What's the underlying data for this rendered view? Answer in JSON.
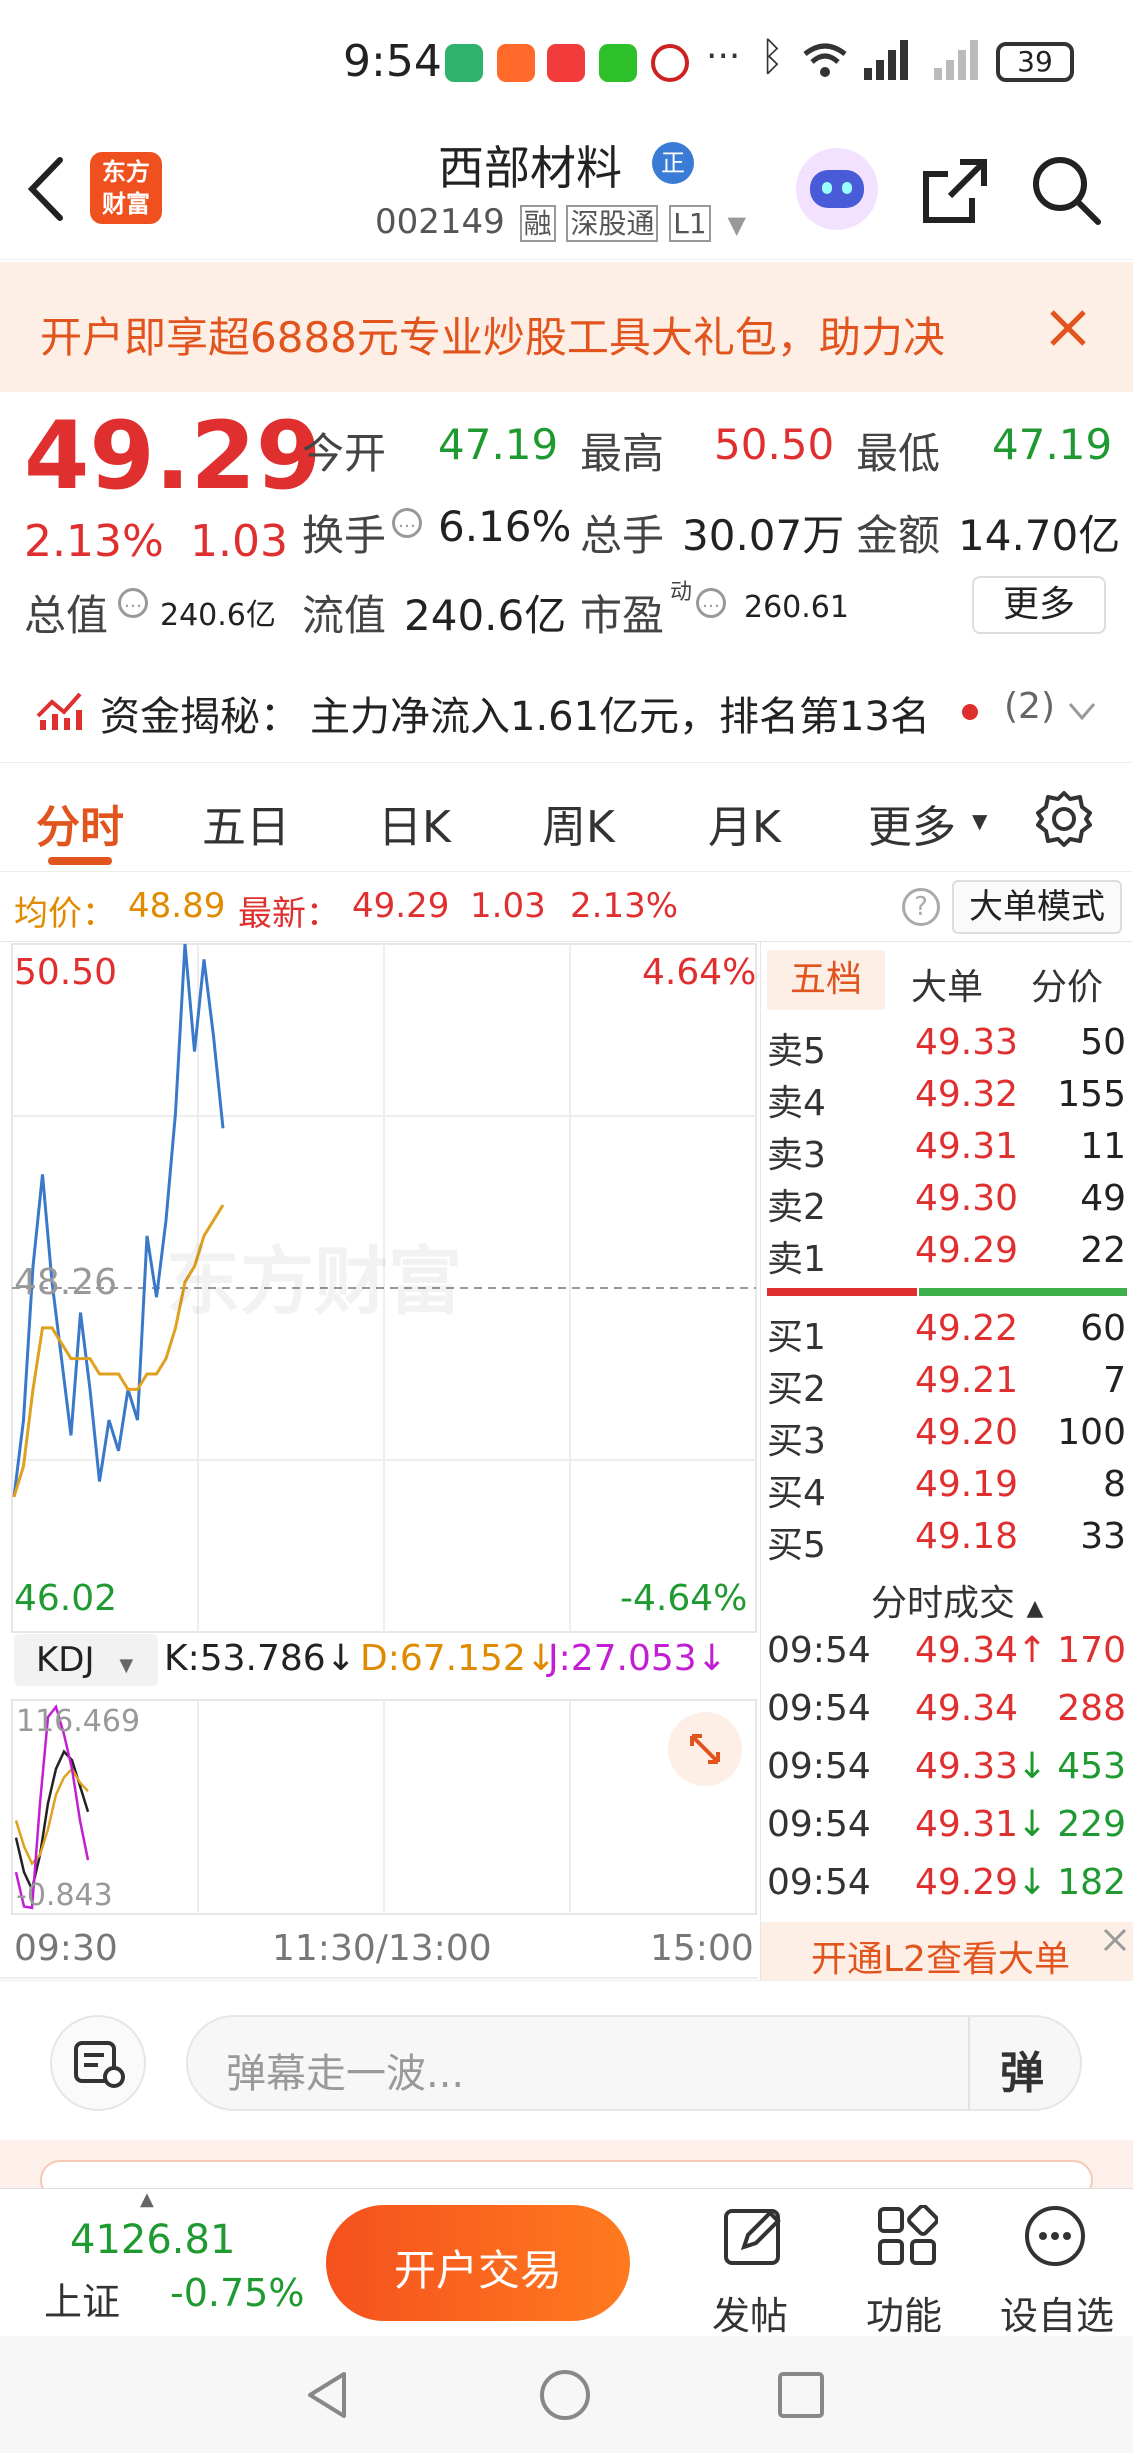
{
  "status": {
    "time": "9:54",
    "battery": "39",
    "more_dots": "···"
  },
  "header": {
    "logo_text_1": "东方",
    "logo_text_2": "财富",
    "stock_name": "西部材料",
    "stock_code": "002149",
    "tags": [
      "融",
      "深股通",
      "L1"
    ],
    "badge": "正"
  },
  "banner": {
    "text": "开户即享超6888元专业炒股工具大礼包，助力决"
  },
  "quote": {
    "price": "49.29",
    "change_pct": "2.13%",
    "change_amt": "1.03",
    "open_label": "今开",
    "open_value": "47.19",
    "high_label": "最高",
    "high_value": "50.50",
    "low_label": "最低",
    "low_value": "47.19",
    "turnover_label": "换手",
    "turnover_value": "6.16%",
    "volume_label": "总手",
    "volume_value": "30.07万",
    "amount_label": "金额",
    "amount_value": "14.70亿",
    "mktcap_label": "总值",
    "mktcap_value": "240.6亿",
    "float_label": "流值",
    "float_value": "240.6亿",
    "pe_label": "市盈",
    "pe_sup": "动",
    "pe_value": "260.61",
    "more_button": "更多",
    "fund_label": "资金揭秘：",
    "fund_text": "主力净流入1.61亿元，排名第13名",
    "fund_count": "(2)"
  },
  "tabs": [
    "分时",
    "五日",
    "日K",
    "周K",
    "月K",
    "更多"
  ],
  "info_line": {
    "avg_label": "均价：",
    "avg_value": "48.89",
    "latest_label": "最新：",
    "latest_value": "49.29",
    "change_amt": "1.03",
    "change_pct": "2.13%",
    "mode_button": "大单模式"
  },
  "chart_data": {
    "type": "line",
    "ylim": [
      46.02,
      50.5
    ],
    "y_top_label": "50.50",
    "y_mid_label": "48.26",
    "y_bottom_label": "46.02",
    "pct_top_label": "4.64%",
    "pct_bottom_label": "-4.64%",
    "x_tick_labels": [
      "09:30",
      "11:30/13:00",
      "15:00"
    ],
    "watermark": "东方财富",
    "series": [
      {
        "name": "最新",
        "color": "#3a78c9",
        "values": [
          46.9,
          47.4,
          48.4,
          49.0,
          48.3,
          47.8,
          47.3,
          48.1,
          47.6,
          47.0,
          47.4,
          47.2,
          47.6,
          47.4,
          48.6,
          48.2,
          48.7,
          49.4,
          50.5,
          49.8,
          50.4,
          49.9,
          49.3
        ]
      },
      {
        "name": "均价",
        "color": "#e0a020",
        "values": [
          46.9,
          47.1,
          47.6,
          48.0,
          48.0,
          47.9,
          47.8,
          47.8,
          47.8,
          47.7,
          47.7,
          47.7,
          47.6,
          47.6,
          47.7,
          47.7,
          47.8,
          48.0,
          48.3,
          48.4,
          48.6,
          48.7,
          48.8
        ]
      }
    ]
  },
  "indicator": {
    "name": "KDJ",
    "k_label": "K:53.786",
    "d_label": "D:67.152",
    "j_label": "J:27.053",
    "top_label": "116.469",
    "bottom_label": "-0.843",
    "k_values": [
      40,
      20,
      10,
      30,
      60,
      80,
      90,
      85,
      70,
      55
    ],
    "d_values": [
      50,
      35,
      25,
      30,
      45,
      65,
      75,
      80,
      72,
      67
    ],
    "j_values": [
      20,
      0,
      -0.8,
      60,
      110,
      116,
      100,
      80,
      50,
      27
    ]
  },
  "orderbook": {
    "tabs": [
      "五档",
      "大单",
      "分价"
    ],
    "asks": [
      {
        "label": "卖5",
        "price": "49.33",
        "vol": "50"
      },
      {
        "label": "卖4",
        "price": "49.32",
        "vol": "155"
      },
      {
        "label": "卖3",
        "price": "49.31",
        "vol": "11"
      },
      {
        "label": "卖2",
        "price": "49.30",
        "vol": "49"
      },
      {
        "label": "卖1",
        "price": "49.29",
        "vol": "22"
      }
    ],
    "bids": [
      {
        "label": "买1",
        "price": "49.22",
        "vol": "60"
      },
      {
        "label": "买2",
        "price": "49.21",
        "vol": "7"
      },
      {
        "label": "买3",
        "price": "49.20",
        "vol": "100"
      },
      {
        "label": "买4",
        "price": "49.19",
        "vol": "8"
      },
      {
        "label": "买5",
        "price": "49.18",
        "vol": "33"
      }
    ],
    "ticks_title": "分时成交",
    "ticks": [
      {
        "time": "09:54",
        "price": "49.34",
        "arrow": "↑",
        "vol": "170"
      },
      {
        "time": "09:54",
        "price": "49.34",
        "arrow": "",
        "vol": "288"
      },
      {
        "time": "09:54",
        "price": "49.33",
        "arrow": "↓",
        "vol": "453"
      },
      {
        "time": "09:54",
        "price": "49.31",
        "arrow": "↓",
        "vol": "229"
      },
      {
        "time": "09:54",
        "price": "49.29",
        "arrow": "↓",
        "vol": "182"
      }
    ],
    "l2_link": "开通L2查看大单"
  },
  "comment": {
    "placeholder": "弹幕走一波...",
    "danmu_button": "弹"
  },
  "bottom": {
    "index_value": "4126.81",
    "index_name": "上证",
    "index_change": "-0.75%",
    "trade_button": "开户交易",
    "post_label": "发帖",
    "func_label": "功能",
    "watch_label": "设自选"
  }
}
